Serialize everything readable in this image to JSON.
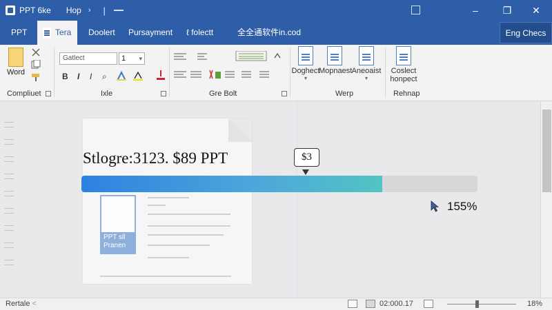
{
  "window": {
    "app_title": "PPT 6ke",
    "menu_help": "Hop",
    "quick_access_1": "›",
    "quick_access_2": "|",
    "controls": {
      "minimize": "–",
      "restore": "❐",
      "close": "✕"
    }
  },
  "tabs": [
    {
      "label": "PPT"
    },
    {
      "label": "Tera"
    },
    {
      "label": "Doolert"
    },
    {
      "label": "Pursayment"
    },
    {
      "label": "ℓ folectt"
    },
    {
      "label": "全全通软件in.cod"
    }
  ],
  "share_button": "Eng Checs",
  "ribbon": {
    "word_label": "Word",
    "group_clipboard": "Compliuet",
    "font_name": "Gatlect",
    "font_size": "1",
    "fmt_bold": "B",
    "fmt_italic": "I",
    "fmt_italic2": "I",
    "fmt_eq": "⌕",
    "group_font": "Ixle",
    "group_paragraph": "Gre Bolt",
    "btn_1": "Doghect",
    "btn_2": "Mopnaest",
    "btn_3": "Aneoaist",
    "group_btns": "Werp",
    "btn_4_line1": "Coslect",
    "btn_4_line2": "honpect",
    "group_last": "Rehnap"
  },
  "document": {
    "thumb_text_1": "PPT sll",
    "thumb_text_2": "Pranen"
  },
  "progress": {
    "label": "Stlogre:3123. $89 PPT",
    "tooltip": "$3",
    "fraction": 0.76,
    "percent_label": "155%"
  },
  "status": {
    "left_text": "Rertale",
    "left_caret": "<",
    "time": "02:000.17",
    "zoom": "18%"
  },
  "colors": {
    "titlebar": "#2f5ea8",
    "progress_start": "#2d82e0",
    "progress_end": "#51c4c3"
  }
}
